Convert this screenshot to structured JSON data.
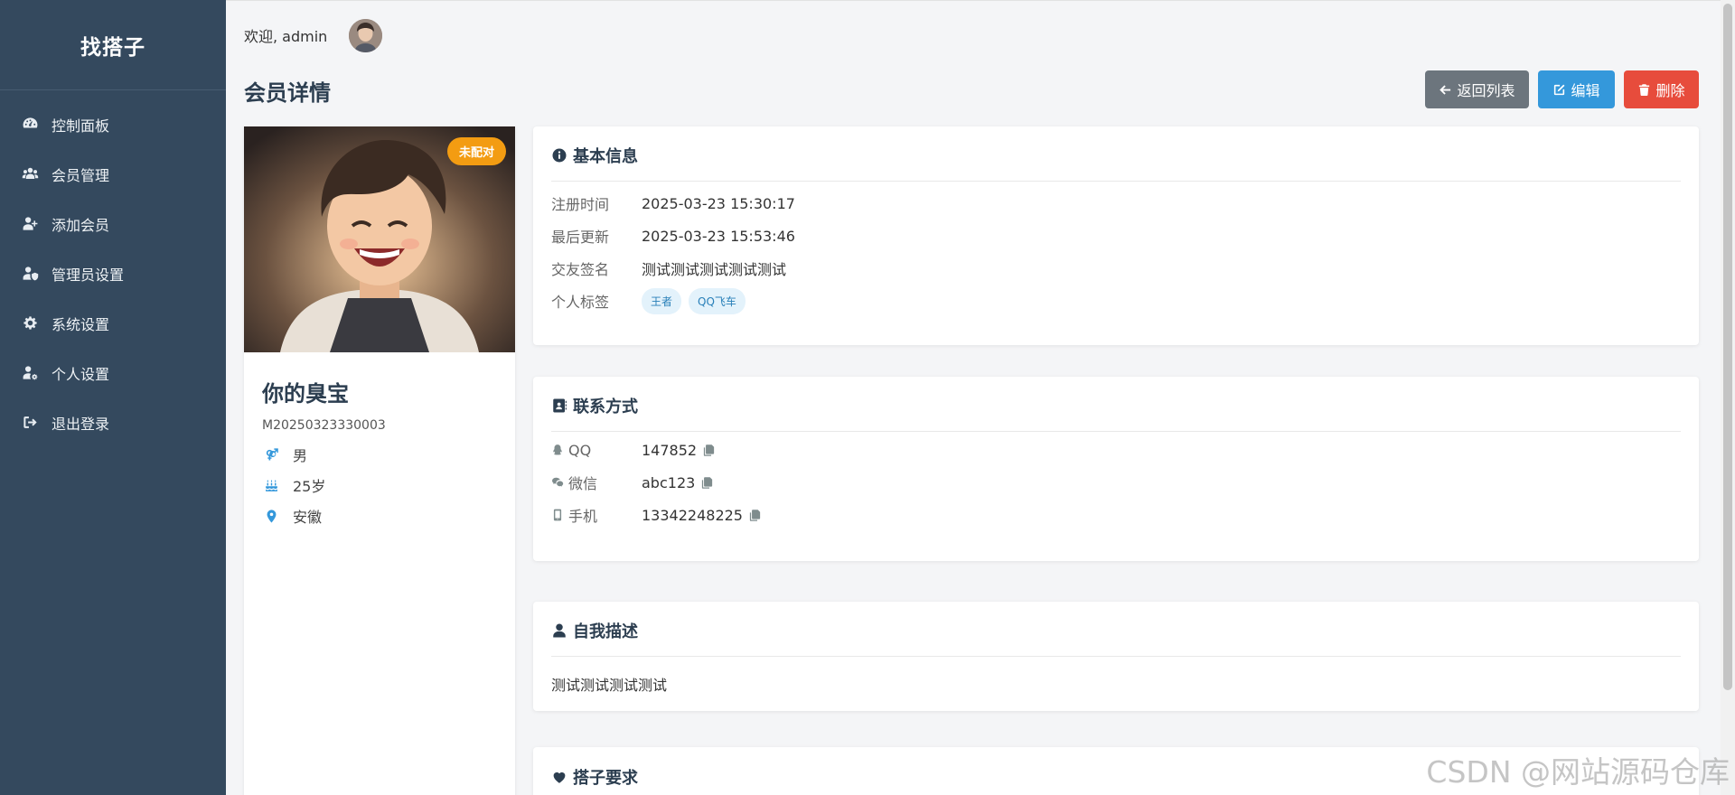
{
  "app": {
    "brand": "找搭子"
  },
  "sidebar": {
    "items": [
      {
        "label": "控制面板",
        "icon": "dashboard-icon"
      },
      {
        "label": "会员管理",
        "icon": "users-icon"
      },
      {
        "label": "添加会员",
        "icon": "user-plus-icon"
      },
      {
        "label": "管理员设置",
        "icon": "user-shield-icon"
      },
      {
        "label": "系统设置",
        "icon": "gear-icon"
      },
      {
        "label": "个人设置",
        "icon": "user-gear-icon"
      },
      {
        "label": "退出登录",
        "icon": "sign-out-icon"
      }
    ]
  },
  "topbar": {
    "welcome": "欢迎, admin"
  },
  "page": {
    "title": "会员详情"
  },
  "actions": {
    "back_label": "返回列表",
    "edit_label": "编辑",
    "delete_label": "删除"
  },
  "profile": {
    "status_badge": "未配对",
    "name": "你的臭宝",
    "member_id": "M20250323330003",
    "gender": "男",
    "age": "25岁",
    "region": "安徽"
  },
  "basic_info": {
    "title": "基本信息",
    "register_label": "注册时间",
    "register_value": "2025-03-23 15:30:17",
    "updated_label": "最后更新",
    "updated_value": "2025-03-23 15:53:46",
    "signature_label": "交友签名",
    "signature_value": "测试测试测试测试测试",
    "tags_label": "个人标签",
    "tags": [
      "王者",
      "QQ飞车"
    ]
  },
  "contact": {
    "title": "联系方式",
    "qq_label": "QQ",
    "qq_value": "147852",
    "wechat_label": "微信",
    "wechat_value": "abc123",
    "phone_label": "手机",
    "phone_value": "13342248225"
  },
  "self_desc": {
    "title": "自我描述",
    "text": "测试测试测试测试"
  },
  "partner_req": {
    "title": "搭子要求"
  },
  "watermark": "CSDN @网站源码仓库",
  "colors": {
    "sidebar_bg": "#34495e",
    "primary": "#3498db",
    "danger": "#e74c3c",
    "secondary": "#6c757d",
    "badge": "#f39c12"
  }
}
